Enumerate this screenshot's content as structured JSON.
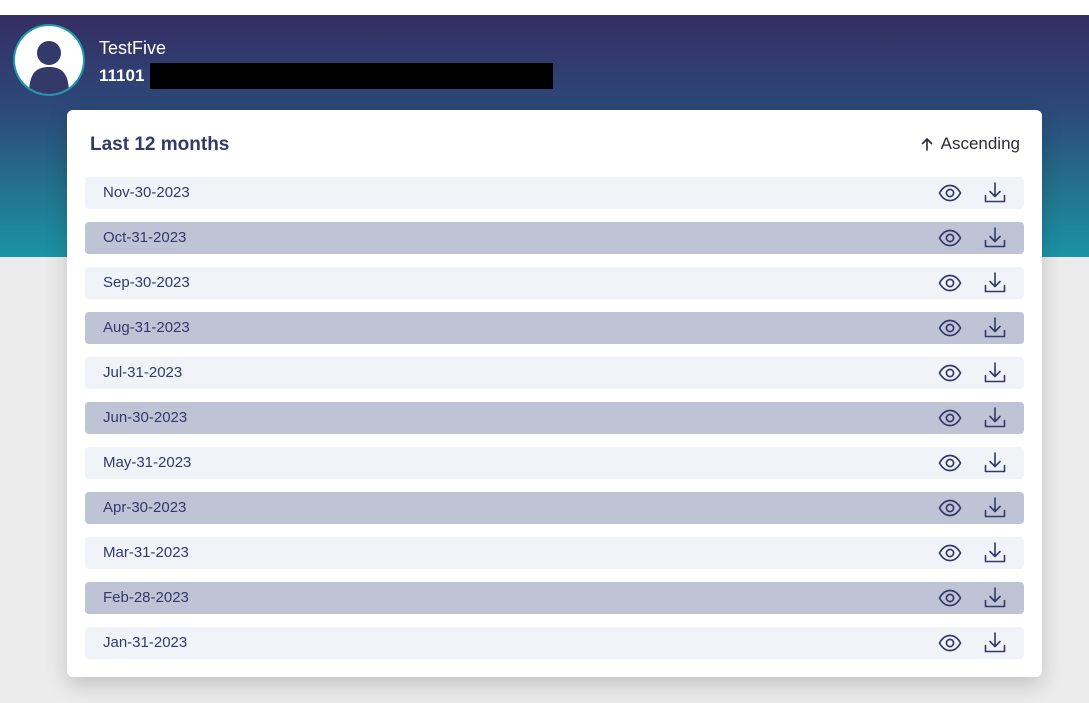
{
  "header": {
    "user_name": "TestFive",
    "user_id": "11101"
  },
  "card": {
    "title": "Last 12 months",
    "sort_label": "Ascending"
  },
  "statements": [
    {
      "date": "Nov-30-2023"
    },
    {
      "date": "Oct-31-2023"
    },
    {
      "date": "Sep-30-2023"
    },
    {
      "date": "Aug-31-2023"
    },
    {
      "date": "Jul-31-2023"
    },
    {
      "date": "Jun-30-2023"
    },
    {
      "date": "May-31-2023"
    },
    {
      "date": "Apr-30-2023"
    },
    {
      "date": "Mar-31-2023"
    },
    {
      "date": "Feb-28-2023"
    },
    {
      "date": "Jan-31-2023"
    }
  ],
  "icons": {
    "row_view": "eye-icon",
    "row_download": "download-icon",
    "sort": "arrow-up-icon",
    "avatar": "user-avatar-icon"
  },
  "colors": {
    "header_top": "#352d63",
    "header_bottom": "#1a94a6",
    "text_primary": "#333a6a",
    "row_light": "#f0f3f8",
    "row_dark": "#bec3d6"
  }
}
